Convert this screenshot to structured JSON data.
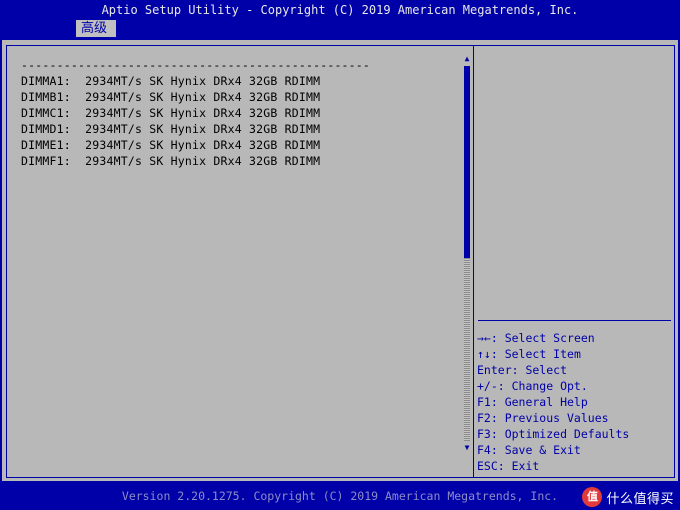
{
  "title": "Aptio Setup Utility - Copyright (C) 2019 American Megatrends, Inc.",
  "tabs": [
    {
      "label": "高级"
    }
  ],
  "content": {
    "separator": "-------------------------------------------------",
    "dimms": [
      {
        "text": "DIMMA1:  2934MT/s SK Hynix DRx4 32GB RDIMM"
      },
      {
        "text": "DIMMB1:  2934MT/s SK Hynix DRx4 32GB RDIMM"
      },
      {
        "text": "DIMMC1:  2934MT/s SK Hynix DRx4 32GB RDIMM"
      },
      {
        "text": "DIMMD1:  2934MT/s SK Hynix DRx4 32GB RDIMM"
      },
      {
        "text": "DIMME1:  2934MT/s SK Hynix DRx4 32GB RDIMM"
      },
      {
        "text": "DIMMF1:  2934MT/s SK Hynix DRx4 32GB RDIMM"
      }
    ]
  },
  "scrollbar": {
    "up_arrow": "▲",
    "down_arrow": "▼"
  },
  "help": [
    {
      "key": "→←",
      "text": ": Select Screen"
    },
    {
      "key": "↑↓",
      "text": ": Select Item"
    },
    {
      "key": "",
      "text": "Enter: Select"
    },
    {
      "key": "",
      "text": "+/-: Change Opt."
    },
    {
      "key": "",
      "text": "F1: General Help"
    },
    {
      "key": "",
      "text": "F2: Previous Values"
    },
    {
      "key": "",
      "text": "F3: Optimized Defaults"
    },
    {
      "key": "",
      "text": "F4: Save & Exit"
    },
    {
      "key": "",
      "text": "ESC: Exit"
    }
  ],
  "footer": "Version 2.20.1275. Copyright (C) 2019 American Megatrends, Inc.",
  "watermark": {
    "logo": "值",
    "text": "什么值得买"
  },
  "colors": {
    "blue": "#0000a8",
    "gray": "#b8b8b8"
  }
}
